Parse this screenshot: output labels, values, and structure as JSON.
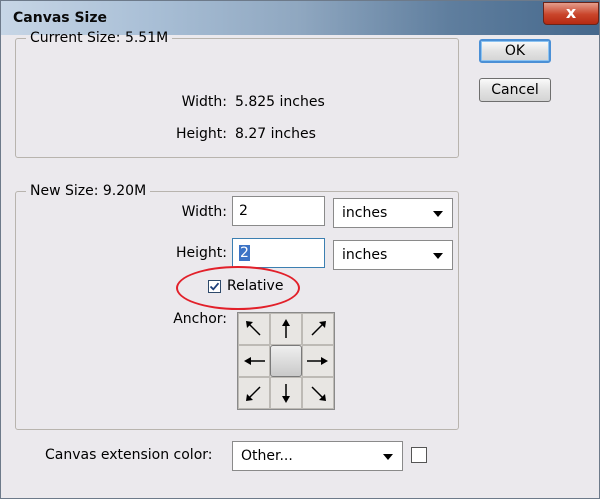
{
  "window": {
    "title": "Canvas Size",
    "close_label": "x"
  },
  "buttons": {
    "ok": "OK",
    "cancel": "Cancel"
  },
  "current_size": {
    "legend": "Current Size: 5.51M",
    "width_label": "Width:",
    "width_value": "5.825 inches",
    "height_label": "Height:",
    "height_value": "8.27 inches"
  },
  "new_size": {
    "legend": "New Size: 9.20M",
    "width_label": "Width:",
    "width_value": "2",
    "width_unit": "inches",
    "height_label": "Height:",
    "height_value": "2",
    "height_unit": "inches",
    "relative_label": "Relative",
    "relative_checked": true,
    "anchor_label": "Anchor:",
    "anchor_selected": "center"
  },
  "extension": {
    "label": "Canvas extension color:",
    "value": "Other...",
    "swatch_color": "#ffffff"
  },
  "icons": {
    "close": "close-icon",
    "dropdown": "chevron-down-icon",
    "check": "checkmark-icon",
    "anchor_arrows": [
      "arrow-up-left-icon",
      "arrow-up-icon",
      "arrow-up-right-icon",
      "arrow-left-icon",
      "anchor-center",
      "arrow-right-icon",
      "arrow-down-left-icon",
      "arrow-down-icon",
      "arrow-down-right-icon"
    ]
  },
  "colors": {
    "highlight": "#e2202a",
    "selection": "#3d74c6"
  }
}
